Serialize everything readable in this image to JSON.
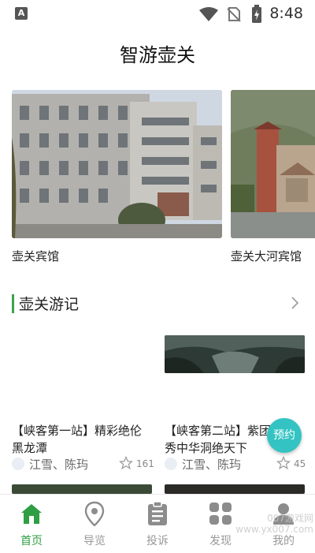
{
  "status_bar": {
    "time": "8:48",
    "notif_letter": "A"
  },
  "header": {
    "title": "智游壶关"
  },
  "hotels": [
    {
      "name": "壶关宾馆"
    },
    {
      "name": "壶关大河宾馆"
    }
  ],
  "section": {
    "title": "壶关游记"
  },
  "travelogues": [
    {
      "title": "【峡客第一站】精彩绝伦黑龙潭",
      "authors": "江雪、陈玙",
      "likes": "161"
    },
    {
      "title": "【峡客第二站】紫团山：秀中华洞绝天下",
      "authors": "江雪、陈玙",
      "likes": "45"
    }
  ],
  "fab": {
    "label": "预约"
  },
  "nav": {
    "items": [
      {
        "label": "首页",
        "icon": "home-icon"
      },
      {
        "label": "导览",
        "icon": "map-pin-icon"
      },
      {
        "label": "投诉",
        "icon": "clipboard-icon"
      },
      {
        "label": "发现",
        "icon": "grid-icon"
      },
      {
        "label": "我的",
        "icon": "person-icon"
      }
    ]
  },
  "watermark": "007游戏网 www.yx007.com",
  "colors": {
    "accent": "#3aa54a",
    "fab": "#34c3c3"
  }
}
